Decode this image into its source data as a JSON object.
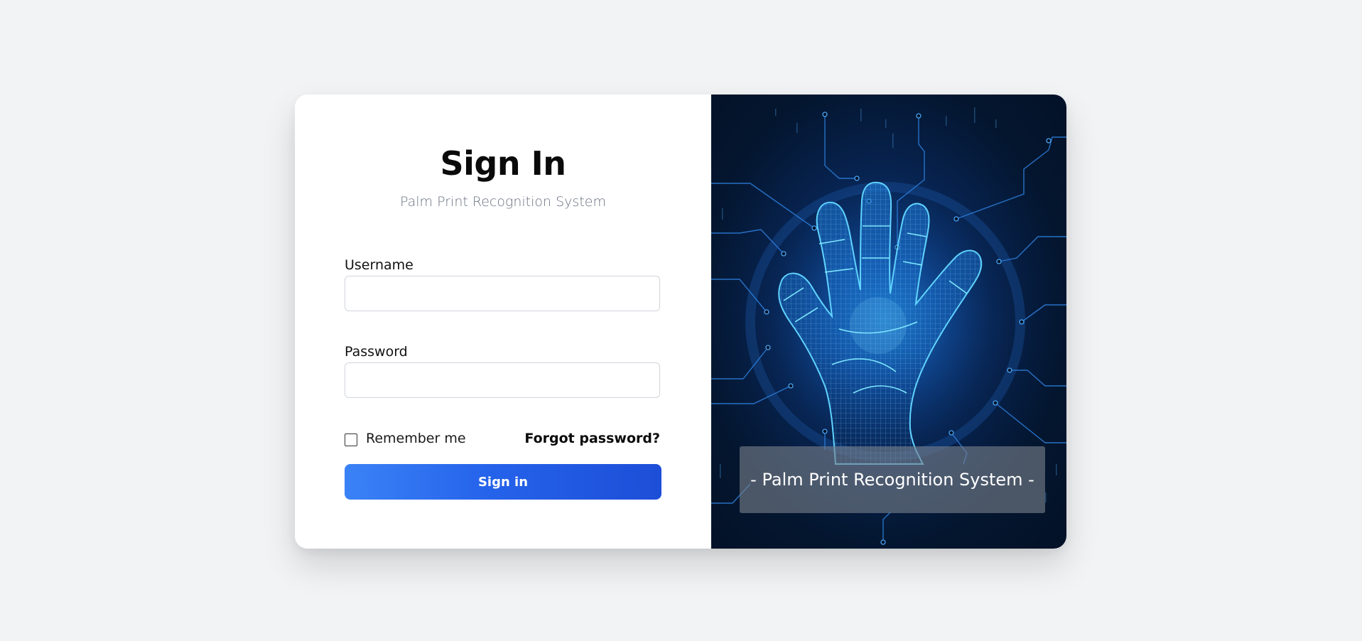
{
  "login": {
    "title": "Sign In",
    "subtitle": "Palm Print Recognition System",
    "username_label": "Username",
    "username_value": "",
    "password_label": "Password",
    "password_value": "",
    "remember_label": "Remember me",
    "remember_checked": false,
    "forgot_label": "Forgot password?",
    "signin_label": "Sign in"
  },
  "hero": {
    "caption": "- Palm Print Recognition System -",
    "image_subject": "glowing wireframe palm hand with circuit lines"
  },
  "colors": {
    "background": "#f2f3f5",
    "accent": "#2563eb",
    "hero_dark": "#031126",
    "hand_glow": "#38bdf8"
  }
}
